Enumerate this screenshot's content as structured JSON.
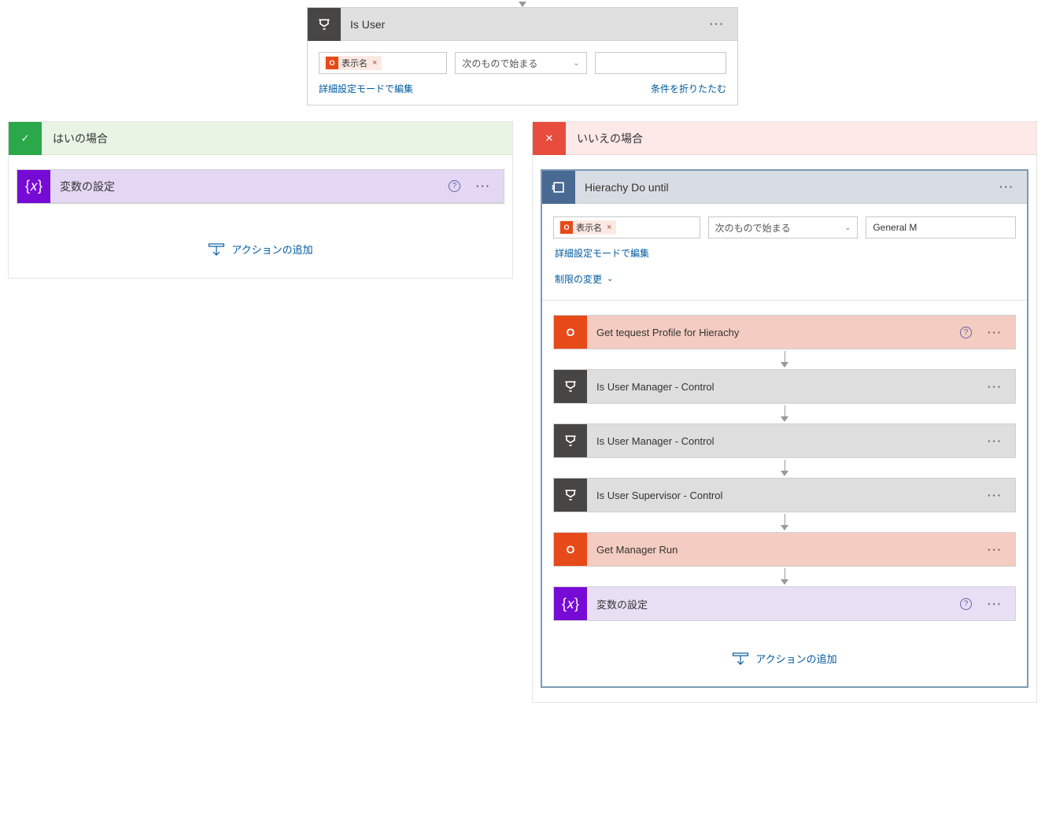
{
  "top": {
    "title": "Is User",
    "chip": "表示名",
    "operator": "次のもので始まる",
    "value": "",
    "edit_link": "詳細設定モードで編集",
    "fold_link": "条件を折りたたむ"
  },
  "branches": {
    "yes": {
      "title": "はいの場合",
      "action1": "変数の設定",
      "add_action": "アクションの追加"
    },
    "no": {
      "title": "いいえの場合",
      "dountil": {
        "title": "Hierachy Do until",
        "chip": "表示名",
        "operator": "次のもので始まる",
        "value": "General M",
        "edit_link": "詳細設定モードで編集",
        "limit_link": "制限の変更",
        "steps": [
          {
            "kind": "office",
            "title": "Get tequest Profile for Hierachy",
            "help": true
          },
          {
            "kind": "control",
            "title": "Is User      Manager - Control"
          },
          {
            "kind": "control",
            "title": "Is User Manager - Control"
          },
          {
            "kind": "control",
            "title": "Is User Supervisor - Control"
          },
          {
            "kind": "office",
            "title": "Get Manager      Run"
          },
          {
            "kind": "var",
            "title": "変数の設定",
            "help": true
          }
        ],
        "add_action": "アクションの追加"
      }
    }
  }
}
